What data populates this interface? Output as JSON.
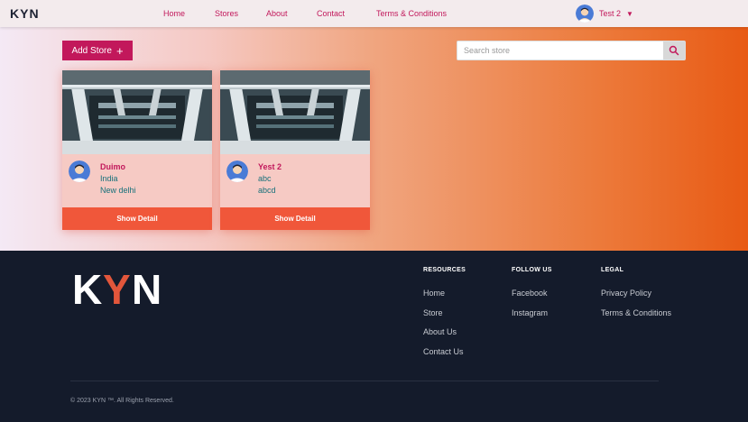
{
  "nav": {
    "logo": {
      "k": "K",
      "y": "Y",
      "n": "N"
    },
    "links": [
      "Home",
      "Stores",
      "About",
      "Contact",
      "Terms & Conditions"
    ],
    "user": {
      "name": "Test 2",
      "avatar_icon": "user-avatar-icon",
      "caret_icon": "caret-down-icon"
    }
  },
  "toolbar": {
    "add_store_label": "Add Store",
    "add_icon": "plus-icon",
    "search_placeholder": "Search store",
    "search_icon": "search-icon"
  },
  "stores": [
    {
      "name": "Duimo",
      "line1": "India",
      "line2": "New delhi",
      "button": "Show Detail"
    },
    {
      "name": "Yest 2",
      "line1": "abc",
      "line2": "abcd",
      "button": "Show Detail"
    }
  ],
  "footer": {
    "logo": {
      "k": "K",
      "y": "Y",
      "n": "N"
    },
    "columns": [
      {
        "title": "RESOURCES",
        "links": [
          "Home",
          "Store",
          "About Us",
          "Contact Us"
        ]
      },
      {
        "title": "FOLLOW US",
        "links": [
          "Facebook",
          "Instagram"
        ]
      },
      {
        "title": "LEGAL",
        "links": [
          "Privacy Policy",
          "Terms & Conditions"
        ]
      }
    ],
    "copyright": "© 2023 KYN ™. All Rights Reserved."
  },
  "colors": {
    "brand": "#c2185b",
    "accent": "#e2563b",
    "button": "#f0573a",
    "footer_bg": "#141b2b"
  }
}
